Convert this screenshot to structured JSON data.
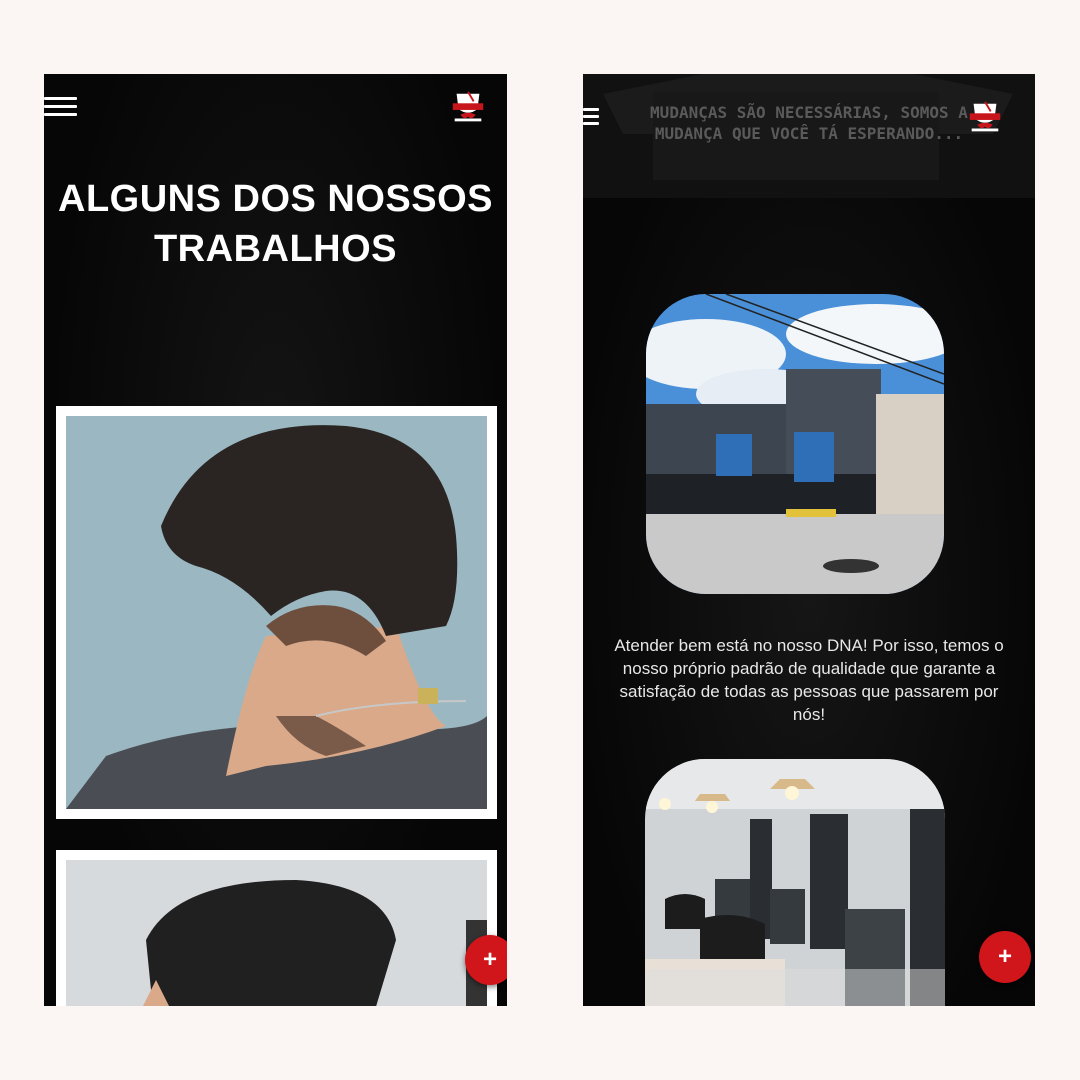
{
  "left_screen": {
    "menu_icon": "hamburger-icon",
    "logo_icon": "barbearia-logo-icon",
    "heading_line1": "ALGUNS DOS NOSSOS",
    "heading_line2": "TRABALHOS",
    "fab_label": "+"
  },
  "right_screen": {
    "menu_icon": "hamburger-icon",
    "logo_icon": "barbearia-logo-icon",
    "banner_text": "MUDANÇAS SÃO NECESSÁRIAS, SOMOS A MUDANÇA QUE VOCÊ TÁ ESPERANDO...",
    "paragraph": "Atender bem está no nosso DNA! Por isso, temos o nosso próprio padrão de qualidade que garante a satisfação de todas as pessoas que passarem por nós!",
    "fab_label": "+"
  },
  "colors": {
    "accent": "#d0161b",
    "background": "#050505",
    "page": "#fbf6f3"
  }
}
